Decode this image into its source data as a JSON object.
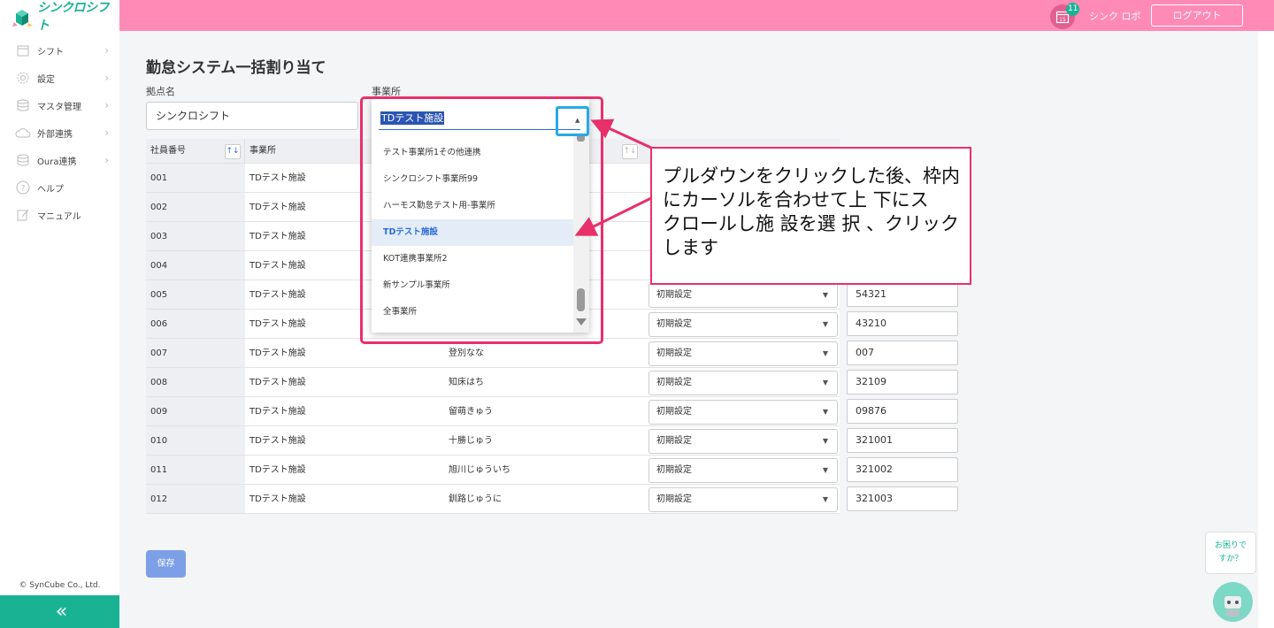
{
  "colors": {
    "header": "#ff8ab5",
    "brand": "#19b394",
    "accent": "#2a6dd9",
    "annotation": "#e8306a",
    "highlight": "#27a9e8"
  },
  "app": {
    "logo_text": "シンクロシフト"
  },
  "header": {
    "calendar_day": "15",
    "notification_count": "11",
    "user_name": "シンク ロボ",
    "logout_label": "ログアウト"
  },
  "sidebar": {
    "items": [
      {
        "label": "シフト",
        "icon": "calendar-icon"
      },
      {
        "label": "設定",
        "icon": "gear-icon"
      },
      {
        "label": "マスタ管理",
        "icon": "database-icon"
      },
      {
        "label": "外部連携",
        "icon": "cloud-icon"
      },
      {
        "label": "Oura連携",
        "icon": "database-icon"
      },
      {
        "label": "ヘルプ",
        "icon": "help-icon"
      },
      {
        "label": "マニュアル",
        "icon": "edit-icon"
      }
    ],
    "copyright": "© SynCube Co., Ltd.",
    "collapse_label": "«"
  },
  "page": {
    "title": "勤怠システム一括割り当て",
    "base_label": "拠点名",
    "base_value": "シンクロシフト",
    "office_label": "事業所"
  },
  "table": {
    "headers": {
      "id": "社員番号",
      "office": "事業所"
    },
    "rows": [
      {
        "id": "001",
        "office": "TDテスト施設",
        "name": "",
        "setting": "",
        "code": ""
      },
      {
        "id": "002",
        "office": "TDテスト施設",
        "name": "",
        "setting": "",
        "code": ""
      },
      {
        "id": "003",
        "office": "TDテスト施設",
        "name": "",
        "setting": "",
        "code": ""
      },
      {
        "id": "004",
        "office": "TDテスト施設",
        "name": "",
        "setting": "",
        "code": ""
      },
      {
        "id": "005",
        "office": "TDテスト施設",
        "name": "",
        "setting": "初期設定",
        "code": "54321"
      },
      {
        "id": "006",
        "office": "TDテスト施設",
        "name": "",
        "setting": "初期設定",
        "code": "43210"
      },
      {
        "id": "007",
        "office": "TDテスト施設",
        "name": "登別なな",
        "setting": "初期設定",
        "code": "007"
      },
      {
        "id": "008",
        "office": "TDテスト施設",
        "name": "知床はち",
        "setting": "初期設定",
        "code": "32109"
      },
      {
        "id": "009",
        "office": "TDテスト施設",
        "name": "留萌きゅう",
        "setting": "初期設定",
        "code": "09876"
      },
      {
        "id": "010",
        "office": "TDテスト施設",
        "name": "十勝じゅう",
        "setting": "初期設定",
        "code": "321001"
      },
      {
        "id": "011",
        "office": "TDテスト施設",
        "name": "旭川じゅういち",
        "setting": "初期設定",
        "code": "321002"
      },
      {
        "id": "012",
        "office": "TDテスト施設",
        "name": "釧路じゅうに",
        "setting": "初期設定",
        "code": "321003"
      }
    ]
  },
  "save_label": "保存",
  "dropdown": {
    "selected": "TDテスト施設",
    "options": [
      "テスト事業所1その他連携",
      "シンクロシフト事業所99",
      "ハーモス勤怠テスト用-事業所",
      "TDテスト施設",
      "KOT連携事業所2",
      "新サンプル事業所",
      "全事業所"
    ],
    "active_index": 3
  },
  "annotation": {
    "lines": [
      "プルダウンをクリックした後、枠内",
      "にカーソルを合わせて上 下にス",
      "クロールし施 設を選 択 、クリック",
      "します"
    ]
  },
  "help": {
    "bubble_line1": "お困りで",
    "bubble_line2": "すか？"
  }
}
